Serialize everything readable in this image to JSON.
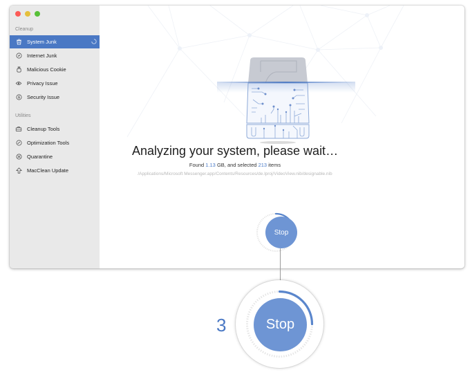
{
  "window": {
    "traffic_lights": [
      {
        "name": "close",
        "color": "#fc5b57"
      },
      {
        "name": "minimize",
        "color": "#e5bf3c"
      },
      {
        "name": "zoom",
        "color": "#57c038"
      }
    ]
  },
  "sidebar": {
    "sections": [
      {
        "title": "Cleanup",
        "items": [
          {
            "label": "System Junk",
            "icon": "trash-icon",
            "active": true,
            "loading": true
          },
          {
            "label": "Internet Junk",
            "icon": "compass-icon"
          },
          {
            "label": "Malicious Cookie",
            "icon": "cookie-jar-icon"
          },
          {
            "label": "Privacy Issue",
            "icon": "eye-icon"
          },
          {
            "label": "Security Issue",
            "icon": "shield-icon"
          }
        ]
      },
      {
        "title": "Utilities",
        "items": [
          {
            "label": "Cleanup Tools",
            "icon": "toolbox-icon"
          },
          {
            "label": "Optimization Tools",
            "icon": "gauge-icon"
          },
          {
            "label": "Quarantine",
            "icon": "quarantine-icon"
          },
          {
            "label": "MacClean Update",
            "icon": "arrow-up-icon"
          }
        ]
      }
    ]
  },
  "main": {
    "title": "Analyzing your system, please wait…",
    "found_prefix": "Found ",
    "found_size": "1.13",
    "found_mid": " GB, and selected ",
    "found_count": "213",
    "found_suffix": " items",
    "current_path": "/Applications/Microsoft Messenger.app/Contents/Resources/de.lproj/VideoView.nib/designable.nib",
    "stop_label": "Stop",
    "progress": 0.25
  },
  "callout": {
    "step_number": "3",
    "stop_label": "Stop"
  },
  "colors": {
    "accent": "#4a78c4",
    "button": "#6e95d4",
    "highlight_text": "#4a7bc8"
  }
}
